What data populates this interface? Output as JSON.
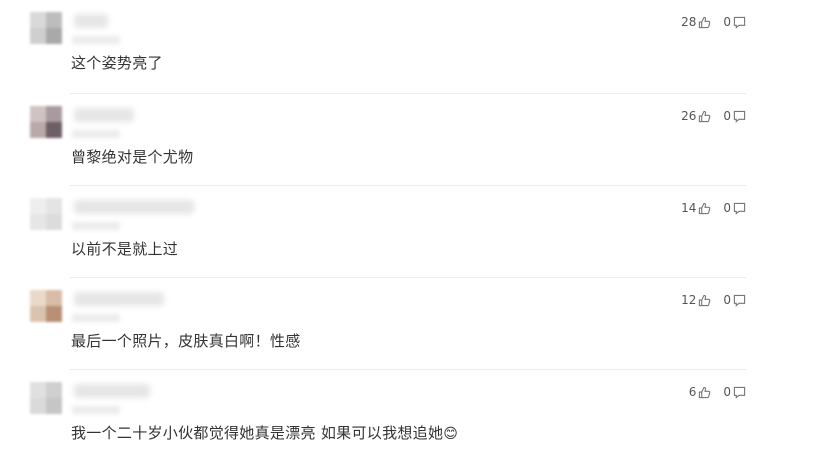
{
  "comments": [
    {
      "text": "这个姿势亮了",
      "likes": "28",
      "replies": "0",
      "avatar_colors": [
        "#d9d9d9",
        "#bdbdbd",
        "#cfcfcf",
        "#a9a9a9"
      ]
    },
    {
      "text": "曾黎绝对是个尤物",
      "likes": "26",
      "replies": "0",
      "avatar_colors": [
        "#cfc3c3",
        "#a89b9f",
        "#b9a9a9",
        "#6e5e66"
      ]
    },
    {
      "text": "以前不是就上过",
      "likes": "14",
      "replies": "0",
      "avatar_colors": [
        "#eeeeee",
        "#e4e4e4",
        "#e6e6e6",
        "#dcdcdc"
      ]
    },
    {
      "text": "最后一个照片，皮肤真白啊！性感",
      "likes": "12",
      "replies": "0",
      "avatar_colors": [
        "#ead9c9",
        "#d8bda6",
        "#d9c3b0",
        "#b88f73"
      ]
    },
    {
      "text": "我一个二十岁小伙都觉得她真是漂亮 如果可以我想追她",
      "emoji": "😊",
      "likes": "6",
      "replies": "0",
      "avatar_colors": [
        "#e0e0e0",
        "#cfcfcf",
        "#dadada",
        "#c6c6c6"
      ]
    }
  ]
}
